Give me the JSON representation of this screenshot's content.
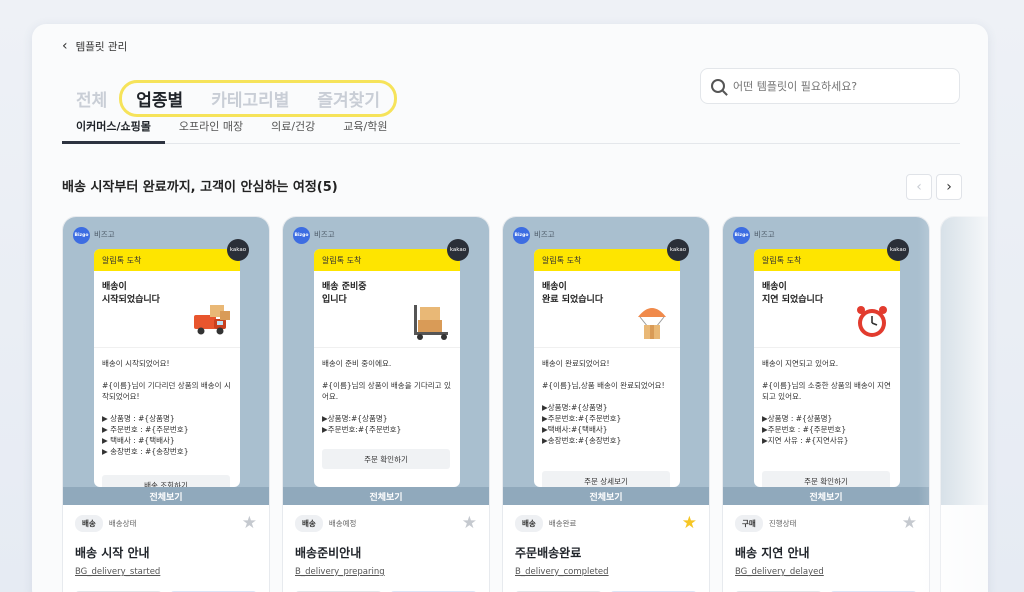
{
  "header": {
    "back_label": "템플릿 관리"
  },
  "segments": {
    "all": "전체",
    "items": [
      "업종별",
      "카테고리별",
      "즐겨찾기"
    ],
    "active_index": 0,
    "highlight_color": "#f6e35a"
  },
  "search": {
    "placeholder": "어떤 템플릿이 필요하세요?"
  },
  "subtabs": [
    "이커머스/쇼핑몰",
    "오프라인 매장",
    "의료/건강",
    "교육/학원"
  ],
  "section": {
    "title": "배송 시작부터 완료까지, 고객이 안심하는 여정(5)"
  },
  "preview_common": {
    "brand_logo_text": "Bizgo",
    "brand_name": "비즈고",
    "kakao_label": "kakao",
    "bubble_header": "알림톡 도착",
    "view_all": "전체보기"
  },
  "cards": [
    {
      "bubble_title": "배송이\n시작되었습니다",
      "illustration": "delivery-truck-icon",
      "body": "배송이 시작되었어요!\n\n#{이름}님이 기다리던 상품의 배송이 시작되었어요!\n\n▶ 상품명 : #{상품명}\n▶ 주문번호 : #{주문번호}\n▶ 택배사 : #{택배사}\n▶ 송장번호 : #{송장번호}",
      "button": "배송 조회하기",
      "tag": "배송",
      "subtag": "배송상태",
      "starred": false,
      "name": "배송 시작 안내",
      "code": "BG_delivery_started"
    },
    {
      "bubble_title": "배송 준비중\n입니다",
      "illustration": "hand-truck-boxes-icon",
      "body": "배송이 준비 중이에요.\n\n#{이름}님의 상품이 배송을 기다리고 있어요.\n\n▶상품명:#{상품명}\n▶주문번호:#{주문번호}",
      "button": "주문 확인하기",
      "tag": "배송",
      "subtag": "배송예정",
      "starred": false,
      "name": "배송준비안내",
      "code": "B_delivery_preparing"
    },
    {
      "bubble_title": "배송이\n완료 되었습니다",
      "illustration": "parachute-box-icon",
      "body": "배송이 완료되었어요!\n\n#{이름}님,상품 배송이 완료되었어요!\n\n▶상품명:#{상품명}\n▶주문번호:#{주문번호}\n▶택배사:#{택배사}\n▶송장번호:#{송장번호}",
      "button": "주문 상세보기",
      "tag": "배송",
      "subtag": "배송완료",
      "starred": true,
      "name": "주문배송완료",
      "code": "B_delivery_completed"
    },
    {
      "bubble_title": "배송이\n지연 되었습니다",
      "illustration": "alarm-clock-icon",
      "body": "배송이 지연되고 있어요.\n\n#{이름}님의 소중한 상품의 배송이 지연되고 있어요.\n\n▶상품명 : #{상품명}\n▶주문번호 : #{주문번호}\n▶지연 사유 : #{지연사유}",
      "button": "주문 확인하기",
      "tag": "구매",
      "subtag": "진행상태",
      "starred": false,
      "name": "배송 지연 안내",
      "code": "BG_delivery_delayed"
    }
  ],
  "colors": {
    "preview_bg": "#a9bfcf",
    "bubble_header": "#fee500",
    "star_on": "#f6c624",
    "star_off": "#c5c9cf"
  }
}
